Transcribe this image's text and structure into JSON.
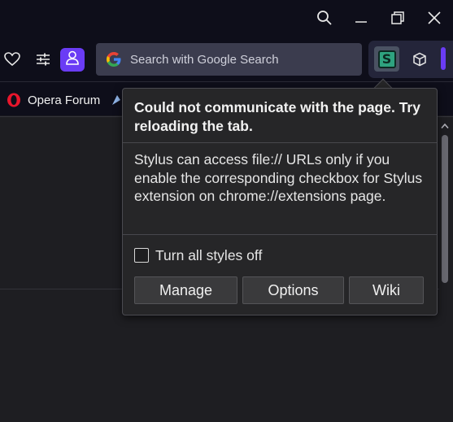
{
  "window": {
    "icons": [
      "search-icon",
      "minimize-icon",
      "restore-icon",
      "close-icon"
    ]
  },
  "toolbar": {
    "search_placeholder": "Search with Google Search",
    "icons": [
      "heart-icon",
      "sliders-icon",
      "profile-icon",
      "google-icon",
      "stylus-extension-icon",
      "cube-icon"
    ],
    "accent": "#6a3cf5"
  },
  "bookmarks": {
    "items": [
      {
        "label": "Opera Forum",
        "icon": "opera-icon"
      }
    ]
  },
  "popup": {
    "error_message": "Could not communicate with the page. Try reloading the tab.",
    "info_message": "Stylus can access file:// URLs only if you enable the corresponding checkbox for Stylus extension on chrome://extensions page.",
    "checkbox_label": "Turn all styles off",
    "checkbox_checked": false,
    "buttons": {
      "manage": "Manage",
      "options": "Options",
      "wiki": "Wiki"
    }
  }
}
